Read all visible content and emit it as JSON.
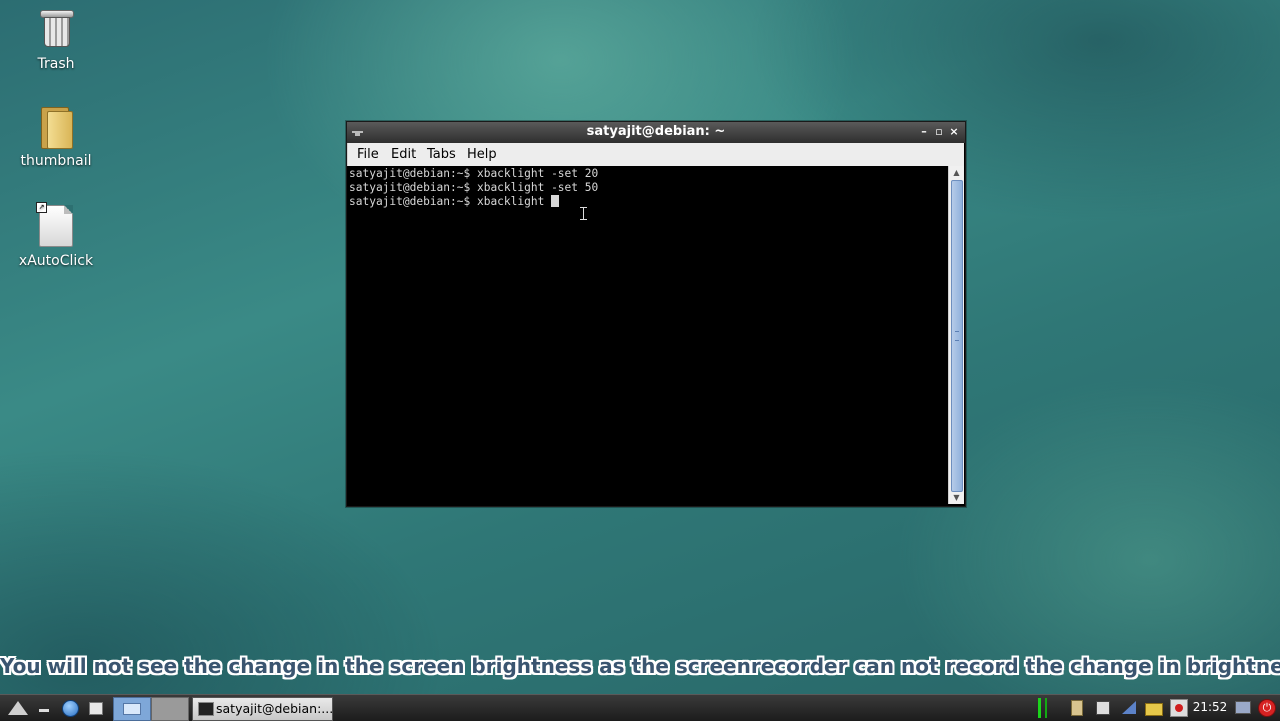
{
  "desktop": {
    "icons": [
      {
        "label": "Trash",
        "icon": "trash-icon"
      },
      {
        "label": "thumbnail",
        "icon": "folder-icon"
      },
      {
        "label": "xAutoClick",
        "icon": "document-icon"
      }
    ]
  },
  "window": {
    "title": "satyajit@debian: ~",
    "controls": {
      "minimize": "–",
      "maximize": "▫",
      "close": "×"
    },
    "menu": [
      {
        "label": "File"
      },
      {
        "label": "Edit"
      },
      {
        "label": "Tabs"
      },
      {
        "label": "Help"
      }
    ],
    "terminal_lines": [
      "satyajit@debian:~$ xbacklight -set 20",
      "satyajit@debian:~$ xbacklight -set 50",
      "satyajit@debian:~$ xbacklight "
    ]
  },
  "caption": "You will not see the change in the screen brightness as the screenrecorder can not record the change in brightness.",
  "taskbar": {
    "task_label": "satyajit@debian:...",
    "clock": "21:52",
    "power_symbol": "⏻",
    "colors": {
      "tray_separator": "#1bd41b",
      "power": "#d62222"
    }
  }
}
